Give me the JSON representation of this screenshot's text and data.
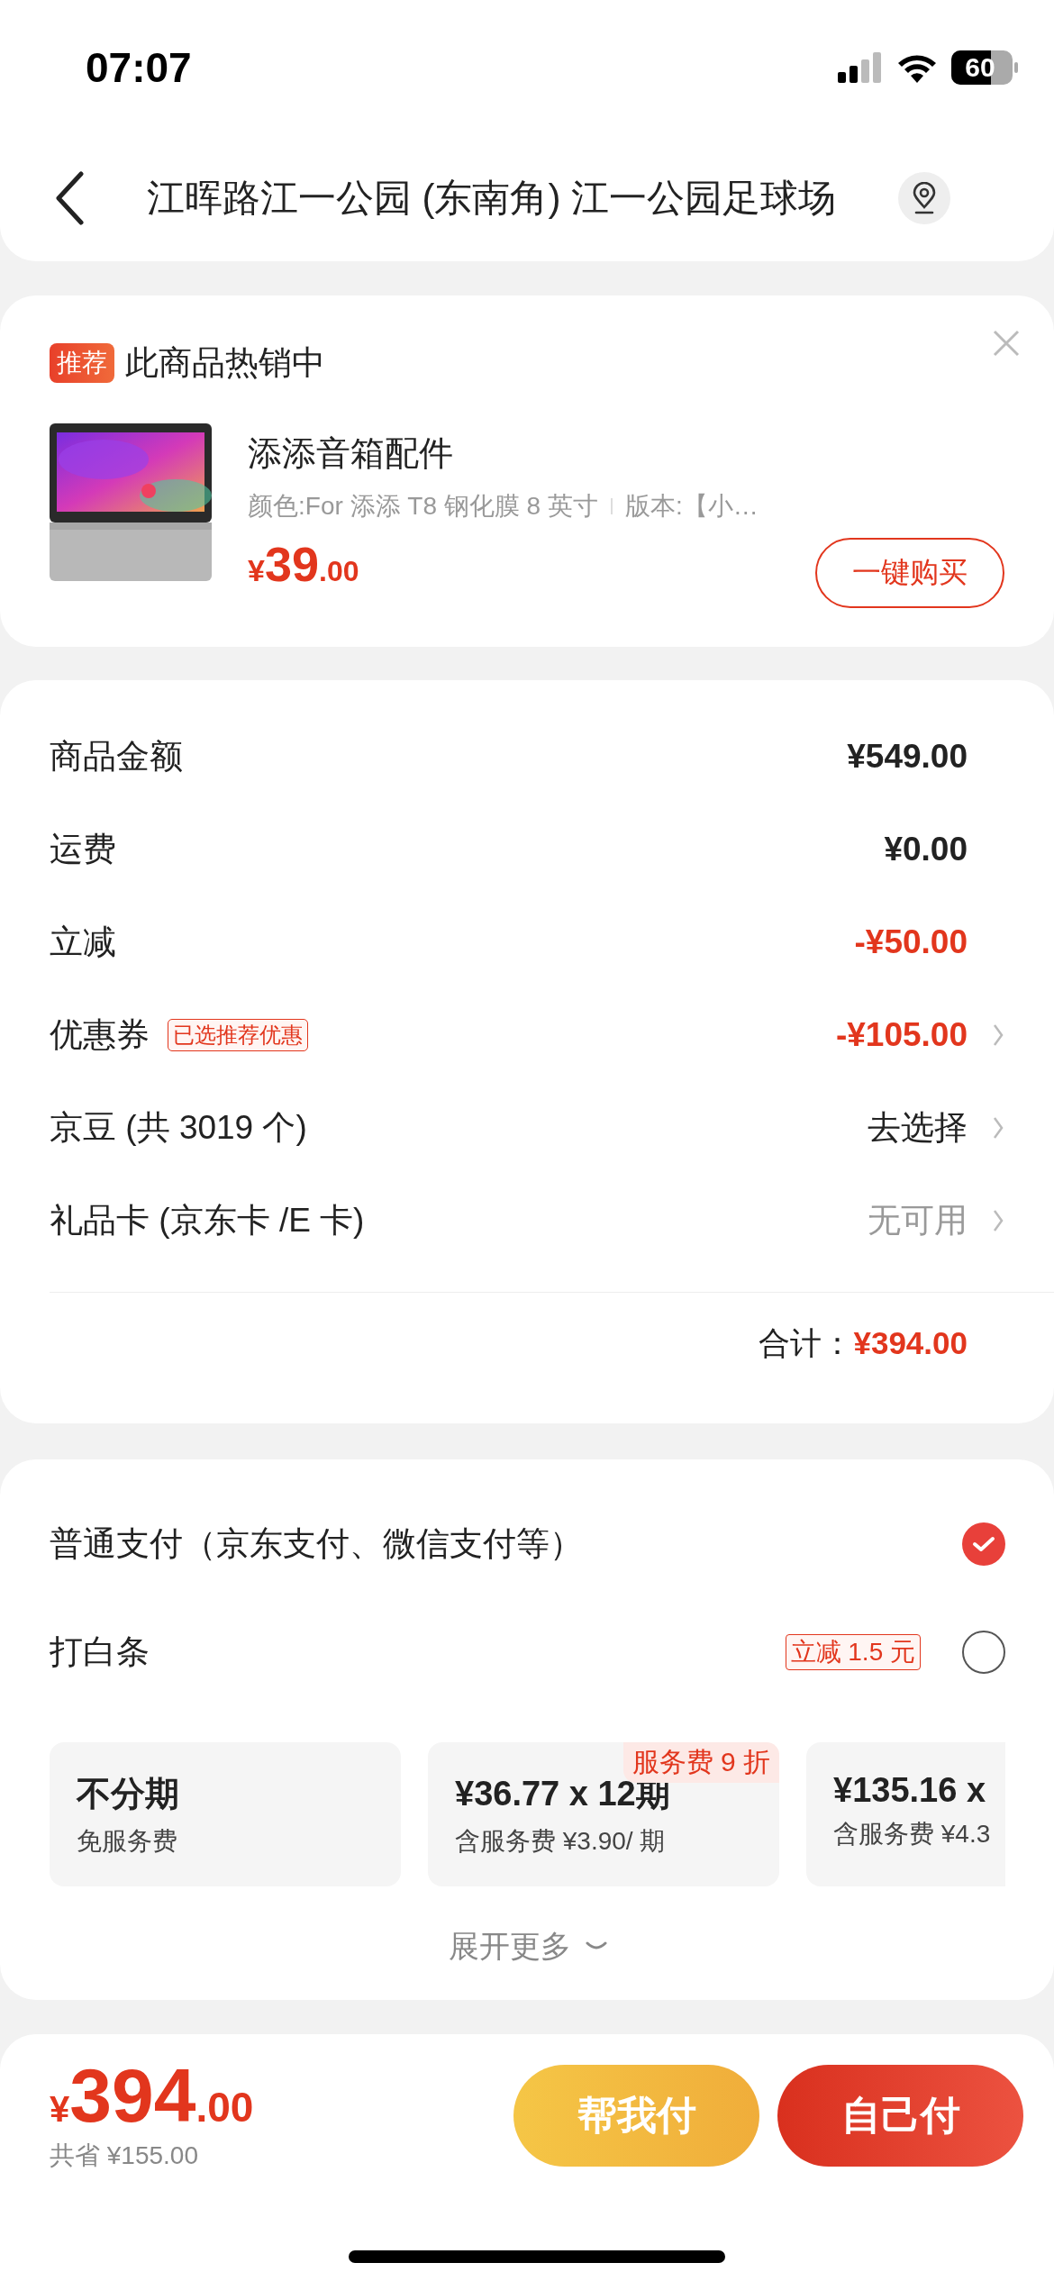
{
  "status_bar": {
    "time": "07:07",
    "battery": "60"
  },
  "header": {
    "title": "江晖路江一公园 (东南角) 江一公园足球场"
  },
  "recommendation": {
    "badge": "推荐",
    "heading": "此商品热销中",
    "product": {
      "kind": "picture",
      "name": "添添音箱配件",
      "spec": "颜色:For 添添 T8 钢化膜 8 英寸",
      "spec_2": "版本:【小…",
      "price_symbol": "¥",
      "price_integer": "39",
      "price_decimal": ".00"
    },
    "buy_button": "一键购买"
  },
  "summary": {
    "rows": [
      {
        "label": "商品金额",
        "value": "¥549.00",
        "kind": "amount",
        "chevron": false
      },
      {
        "label": "运费",
        "value": "¥0.00",
        "kind": "amount",
        "chevron": false
      },
      {
        "label": "立减",
        "value": "-¥50.00",
        "kind": "discount",
        "chevron": false
      },
      {
        "label": "优惠券",
        "tag": "已选推荐优惠",
        "value": "-¥105.00",
        "kind": "discount",
        "chevron": true
      },
      {
        "label": "京豆 (共 3019 个)",
        "value": "去选择",
        "kind": "action",
        "chevron": true
      },
      {
        "label": "礼品卡 (京东卡 /E 卡)",
        "value": "无可用",
        "kind": "unavailable",
        "chevron": true
      }
    ],
    "total_label": "合计：",
    "total_value": "¥394.00"
  },
  "payment": {
    "methods": [
      {
        "label": "普通支付（京东支付、微信支付等）",
        "selected": true
      },
      {
        "label": "打白条",
        "tag": "立减 1.5 元",
        "selected": false
      }
    ],
    "installments": [
      {
        "title": "不分期",
        "subtitle": "免服务费"
      },
      {
        "title": "¥36.77 x 12期",
        "subtitle": "含服务费 ¥3.90/ 期",
        "tag": "服务费 9 折"
      },
      {
        "title": "¥135.16 x",
        "subtitle": "含服务费 ¥4.3"
      }
    ],
    "expand": "展开更多"
  },
  "bottom_bar": {
    "price_symbol": "¥",
    "price_integer": "394",
    "price_decimal": ".00",
    "saved": "共省 ¥155.00",
    "buttons": [
      {
        "label": "帮我付",
        "kind": "secondary"
      },
      {
        "label": "自己付",
        "kind": "primary"
      }
    ]
  }
}
